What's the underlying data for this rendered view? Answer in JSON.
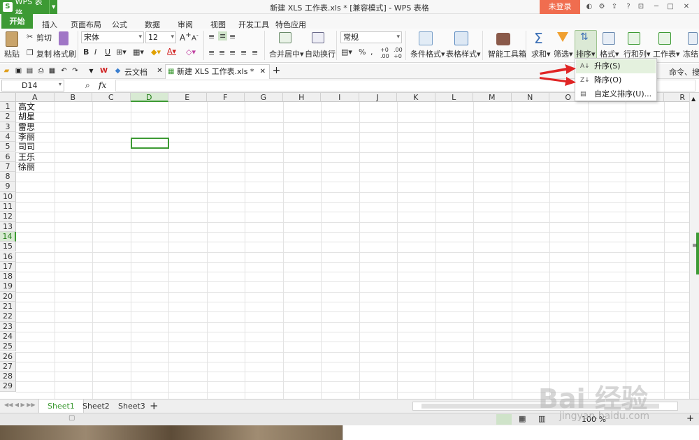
{
  "titlebar": {
    "app_name": "WPS 表格",
    "logo_letter": "S",
    "window_title": "新建 XLS 工作表.xls * [兼容模式] - WPS 表格",
    "login": "未登录"
  },
  "menu": {
    "items": [
      "开始",
      "插入",
      "页面布局",
      "公式",
      "数据",
      "审阅",
      "视图",
      "开发工具",
      "特色应用"
    ]
  },
  "ribbon": {
    "paste": "粘贴",
    "cut": "剪切",
    "copy": "复制",
    "format_painter": "格式刷",
    "font": "宋体",
    "font_size": "12",
    "merge_center": "合并居中",
    "wrap": "自动换行",
    "number_format": "常规",
    "cond_format": "条件格式",
    "table_style": "表格样式",
    "smart_tools": "智能工具箱",
    "sum": "求和",
    "filter": "筛选",
    "sort": "排序",
    "format": "格式",
    "row_col": "行和列",
    "sheet": "工作表",
    "freeze": "冻结",
    "search_hint": "命令、搜索模板"
  },
  "quickbar": {
    "cloud_docs": "云文档",
    "doc_tab": "新建 XLS 工作表.xls *"
  },
  "formula": {
    "cell_ref": "D14",
    "fx": "fx"
  },
  "grid": {
    "columns": [
      "A",
      "B",
      "C",
      "D",
      "E",
      "F",
      "G",
      "H",
      "I",
      "J",
      "K",
      "L",
      "M",
      "N",
      "O",
      "P",
      "Q",
      "R"
    ],
    "selected_column": "D",
    "rows": [
      "1",
      "2",
      "3",
      "4",
      "5",
      "6",
      "7",
      "8",
      "9",
      "10",
      "11",
      "12",
      "13",
      "14",
      "15",
      "16",
      "17",
      "18",
      "19",
      "20",
      "21",
      "22",
      "23",
      "24",
      "25",
      "26",
      "27",
      "28",
      "29"
    ],
    "selected_row": "14",
    "col_a_values": [
      "高文",
      "胡星",
      "雷思",
      "李丽",
      "司司",
      "王乐",
      "徐丽"
    ]
  },
  "sheets": [
    "Sheet1",
    "Sheet2",
    "Sheet3"
  ],
  "status": {
    "zoom": "100 %"
  },
  "sort_menu": {
    "ascending": "升序(S)",
    "descending": "降序(O)",
    "custom": "自定义排序(U)..."
  },
  "watermark": {
    "text": "Bai 经验",
    "url": "jingyan.baidu.com"
  },
  "colors": {
    "accent_green": "#3d9a34",
    "login_orange": "#f06d4f",
    "arrow_red": "#e02424"
  }
}
